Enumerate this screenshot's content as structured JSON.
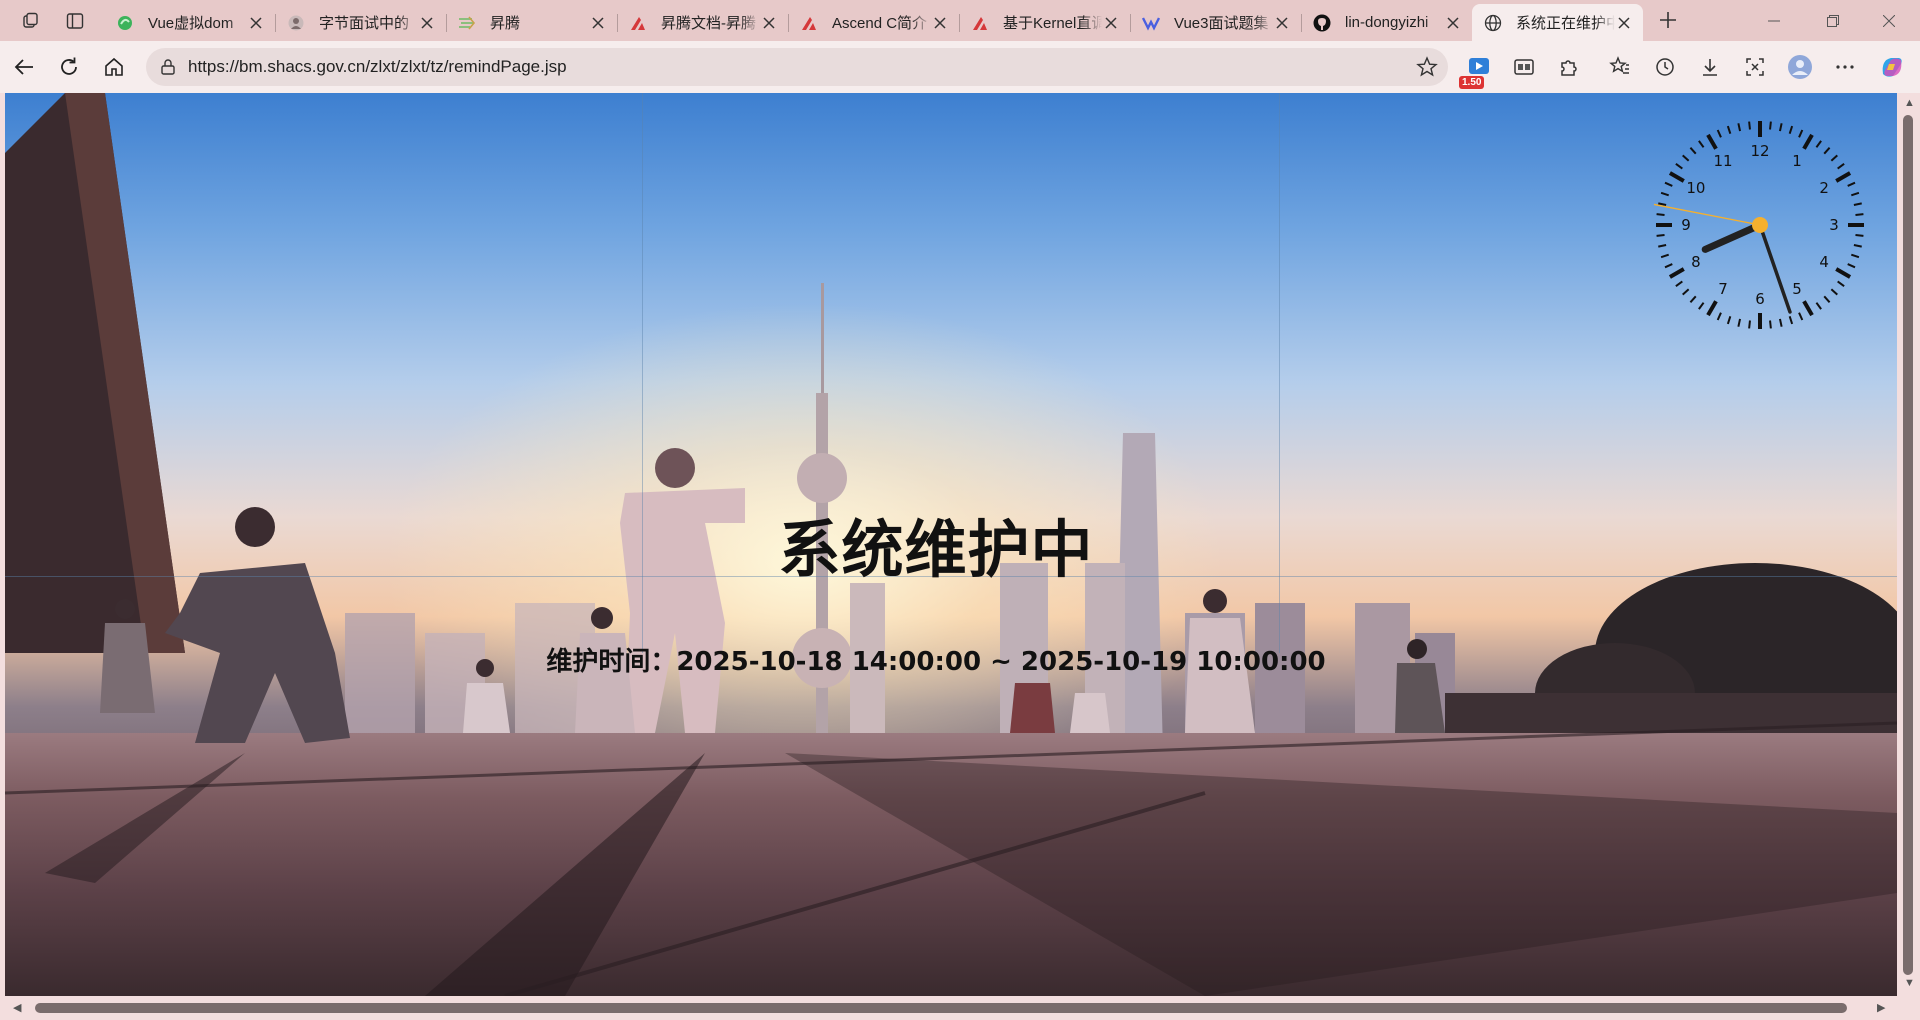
{
  "browser": {
    "tabs": [
      {
        "title": "Vue虚拟dom",
        "favicon": "vue-green-icon"
      },
      {
        "title": "字节面试中的",
        "favicon": "avatar-icon"
      },
      {
        "title": "昇腾",
        "favicon": "ascend-icon"
      },
      {
        "title": "昇腾文档-昇腾",
        "favicon": "ascend-red-icon"
      },
      {
        "title": "Ascend C简介",
        "favicon": "ascend-red-icon"
      },
      {
        "title": "基于Kernel直调",
        "favicon": "ascend-red-icon"
      },
      {
        "title": "Vue3面试题集",
        "favicon": "vue-blue-icon"
      },
      {
        "title": "lin-dongyizhi",
        "favicon": "github-icon"
      },
      {
        "title": "系统正在维护中",
        "favicon": "globe-icon",
        "active": true
      }
    ],
    "url": "https://bm.shacs.gov.cn/zlxt/zlxt/tz/remindPage.jsp",
    "extension_badge": "1.50"
  },
  "page": {
    "title": "系统维护中",
    "maintenance_text": "维护时间：2025-10-18 14:00:00 ~ 2025-10-19 10:00:00",
    "clock": {
      "numerals": [
        "12",
        "1",
        "2",
        "3",
        "4",
        "5",
        "6",
        "7",
        "8",
        "9",
        "10",
        "11"
      ],
      "hour_hand_angle": 246,
      "minute_hand_angle": 161,
      "second_hand_angle": 281,
      "accent": "#f5b02e"
    }
  }
}
